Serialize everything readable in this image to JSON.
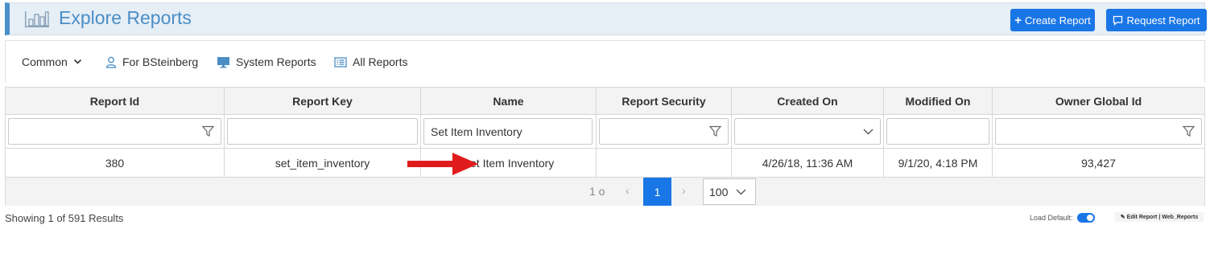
{
  "header": {
    "title": "Explore Reports",
    "create_label": "Create Report",
    "request_label": "Request Report",
    "icon_create": "plus-icon",
    "icon_request": "comment-icon",
    "accent": "#4a90c9",
    "button_color": "#1976e6"
  },
  "nav": {
    "common": "Common",
    "for_user": "For BSteinberg",
    "system": "System Reports",
    "all": "All Reports"
  },
  "table": {
    "columns": [
      "Report Id",
      "Report Key",
      "Name",
      "Report Security",
      "Created On",
      "Modified On",
      "Owner Global Id"
    ],
    "filters": {
      "name_value": "Set Item Inventory"
    },
    "rows": [
      {
        "report_id": "380",
        "report_key": "set_item_inventory",
        "name": "Set Item Inventory",
        "report_security": "",
        "created_on": "4/26/18, 11:36 AM",
        "modified_on": "9/1/20, 4:18 PM",
        "owner_global_id": "93,427"
      }
    ]
  },
  "pager": {
    "info": "1 o",
    "prev": "‹",
    "current_page": "1",
    "next": "›",
    "page_size": "100"
  },
  "footer": {
    "showing": "Showing 1 of 591 Results",
    "load_default": "Load Default:",
    "edit_report": "Edit Report | Web_Reports"
  }
}
